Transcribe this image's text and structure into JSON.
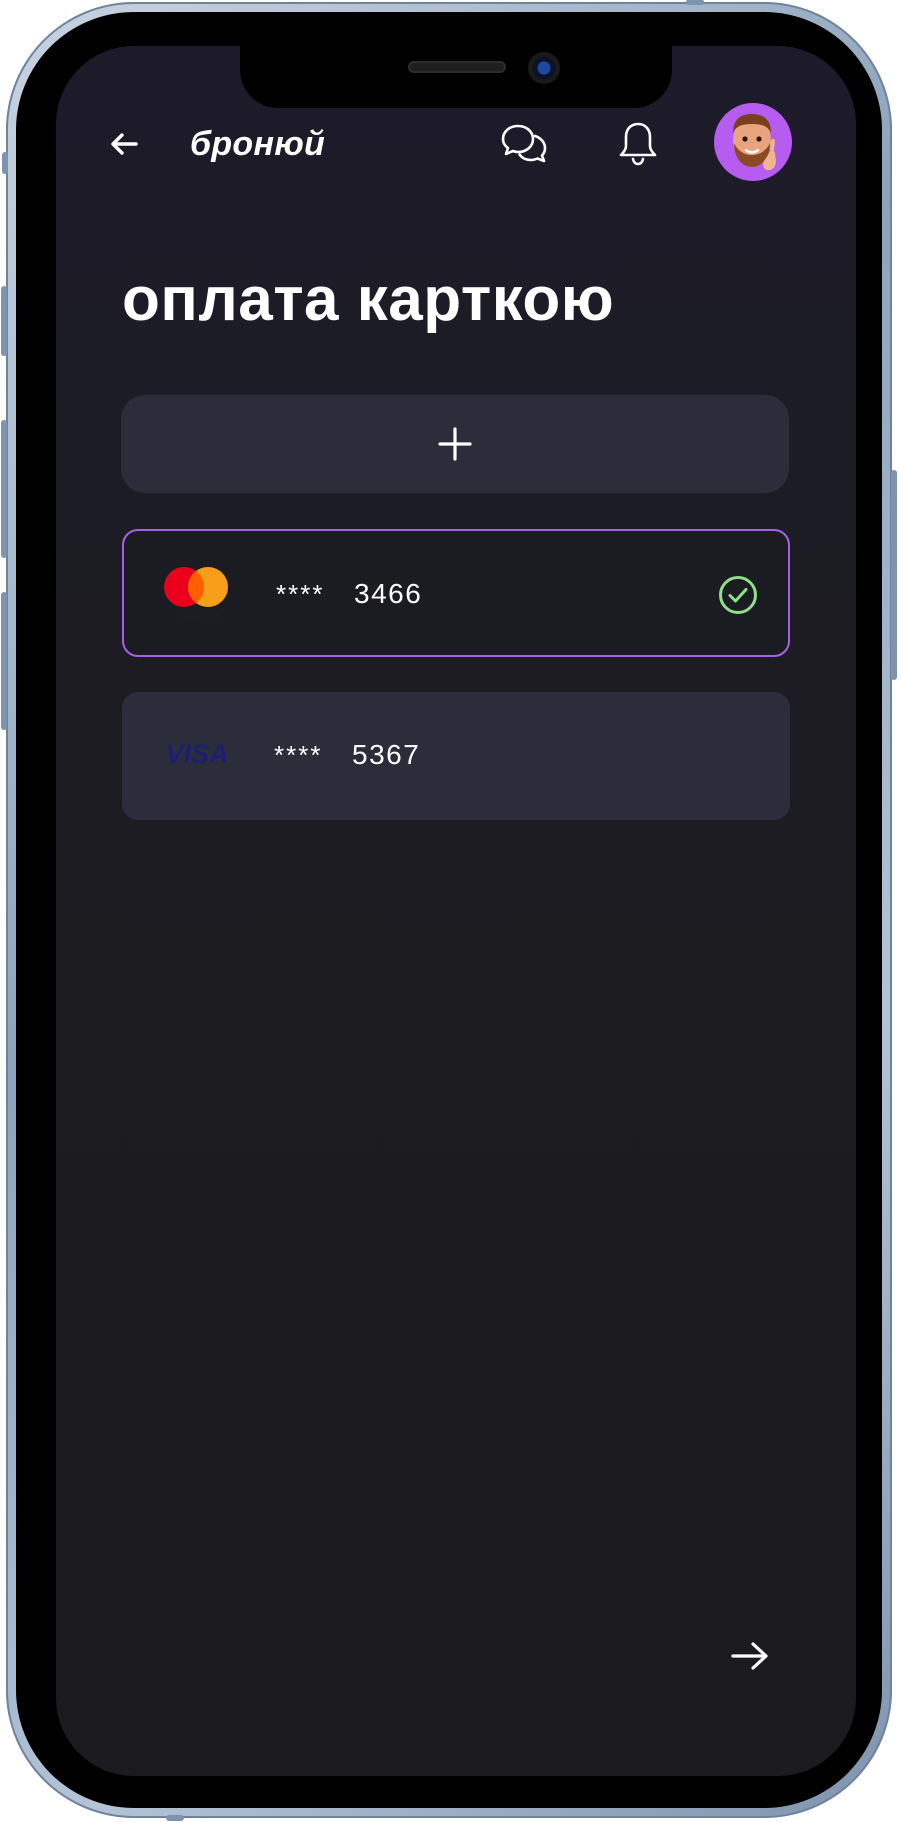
{
  "header": {
    "brand": "бронюй",
    "icons": [
      "back-arrow-icon",
      "chat-icon",
      "bell-icon",
      "avatar"
    ]
  },
  "page": {
    "title": "оплата карткою"
  },
  "add_card": {
    "icon": "plus-icon"
  },
  "cards": [
    {
      "brand": "mastercard",
      "logo_text": "mastercard",
      "mask": "****",
      "last4": "3466",
      "selected": true
    },
    {
      "brand": "visa",
      "logo_text": "VISA",
      "mask": "****",
      "last4": "5367",
      "selected": false
    }
  ],
  "footer": {
    "next_icon": "arrow-right-icon"
  },
  "colors": {
    "background": "#1b1b1f",
    "card_surface": "#2b2d3a",
    "accent_purple": "#a860e6",
    "check_green": "#8ee08a",
    "avatar_bg": "#b65cf0",
    "mastercard_red": "#eb001b",
    "mastercard_orange": "#f79e1b",
    "visa_blue": "#1a1f71"
  }
}
